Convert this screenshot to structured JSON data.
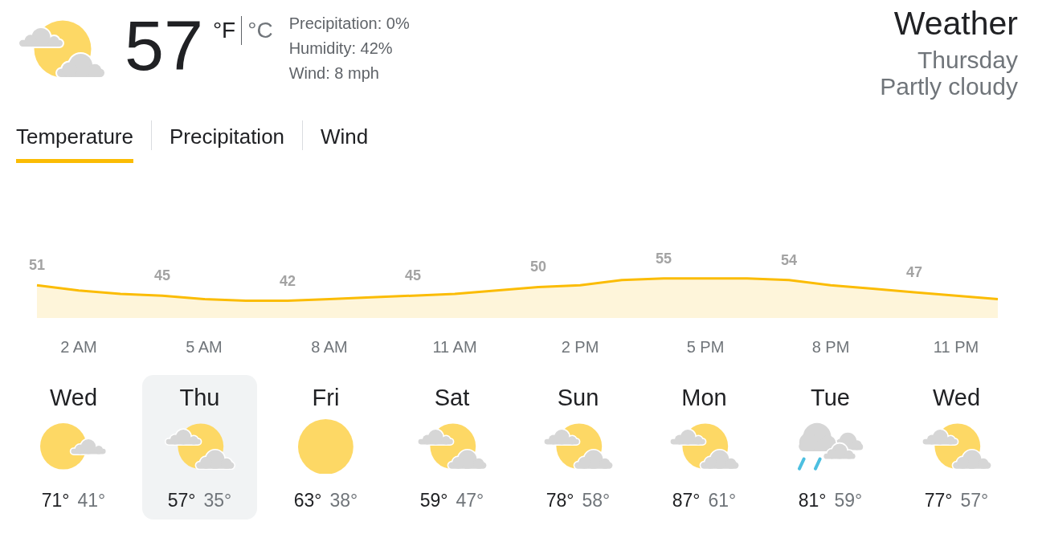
{
  "current": {
    "kind": "partlycloudy",
    "temperature": "57",
    "units": [
      {
        "label": "°F",
        "selected": true
      },
      {
        "label": "°C",
        "selected": false
      }
    ],
    "details": [
      "Precipitation: 0%",
      "Humidity: 42%",
      "Wind: 8 mph"
    ]
  },
  "summary": {
    "title": "Weather",
    "day": "Thursday",
    "condition": "Partly cloudy"
  },
  "tabs": [
    {
      "label": "Temperature",
      "selected": true
    },
    {
      "label": "Precipitation",
      "selected": false
    },
    {
      "label": "Wind",
      "selected": false
    }
  ],
  "chart_data": {
    "type": "area",
    "categories": [
      null,
      "2 AM",
      null,
      null,
      "5 AM",
      null,
      null,
      "8 AM",
      null,
      null,
      "11 AM",
      null,
      null,
      "2 PM",
      null,
      null,
      "5 PM",
      null,
      null,
      "8 PM",
      null,
      null,
      "11 PM",
      null
    ],
    "values": [
      51,
      48,
      46,
      45,
      43,
      42,
      42,
      43,
      44,
      45,
      46,
      48,
      50,
      51,
      54,
      55,
      55,
      55,
      54,
      51,
      49,
      47,
      45,
      43
    ],
    "value_labels": [
      "51",
      null,
      null,
      "45",
      null,
      null,
      "42",
      null,
      null,
      "45",
      null,
      null,
      "50",
      null,
      null,
      "55",
      null,
      null,
      "54",
      null,
      null,
      "47",
      null,
      null
    ],
    "color": "#fbbc04"
  },
  "days": [
    {
      "name": "Wed",
      "kind": "mostlysunny",
      "high": "71°",
      "low": "41°",
      "selected": false
    },
    {
      "name": "Thu",
      "kind": "partlycloudy",
      "high": "57°",
      "low": "35°",
      "selected": true
    },
    {
      "name": "Fri",
      "kind": "sunny",
      "high": "63°",
      "low": "38°",
      "selected": false
    },
    {
      "name": "Sat",
      "kind": "partlycloudy",
      "high": "59°",
      "low": "47°",
      "selected": false
    },
    {
      "name": "Sun",
      "kind": "partlycloudy",
      "high": "78°",
      "low": "58°",
      "selected": false
    },
    {
      "name": "Mon",
      "kind": "partlycloudy",
      "high": "87°",
      "low": "61°",
      "selected": false
    },
    {
      "name": "Tue",
      "kind": "showers",
      "high": "81°",
      "low": "59°",
      "selected": false
    },
    {
      "name": "Wed",
      "kind": "partlycloudy",
      "high": "77°",
      "low": "57°",
      "selected": false
    }
  ]
}
